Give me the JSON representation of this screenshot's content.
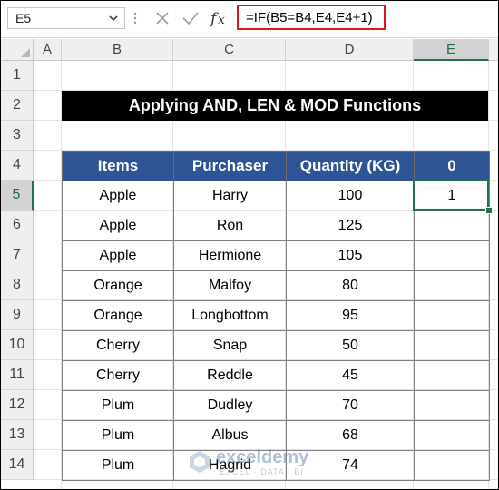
{
  "formula_bar": {
    "name_box": "E5",
    "formula": "=IF(B5=B4,E4,E4+1)",
    "icons": [
      "chevron-down-icon",
      "cancel-x-icon",
      "check-icon",
      "fx-icon"
    ]
  },
  "columns": [
    "A",
    "B",
    "C",
    "D",
    "E"
  ],
  "selected_column": "E",
  "rows": [
    "1",
    "2",
    "3",
    "4",
    "5",
    "6",
    "7",
    "8",
    "9",
    "10",
    "11",
    "12",
    "13",
    "14"
  ],
  "selected_row": "5",
  "sheet": {
    "title": "Applying AND, LEN & MOD Functions",
    "headers": [
      "Items",
      "Purchaser",
      "Quantity (KG)",
      "0"
    ],
    "data": [
      [
        "Apple",
        "Harry",
        "100",
        "1"
      ],
      [
        "Apple",
        "Ron",
        "125",
        ""
      ],
      [
        "Apple",
        "Hermione",
        "105",
        ""
      ],
      [
        "Orange",
        "Malfoy",
        "80",
        ""
      ],
      [
        "Orange",
        "Longbottom",
        "95",
        ""
      ],
      [
        "Cherry",
        "Snap",
        "50",
        ""
      ],
      [
        "Cherry",
        "Reddle",
        "45",
        ""
      ],
      [
        "Plum",
        "Dudley",
        "70",
        ""
      ],
      [
        "Plum",
        "Albus",
        "68",
        ""
      ],
      [
        "Plum",
        "Hagrid",
        "74",
        ""
      ]
    ]
  },
  "watermark": {
    "name": "exceldemy",
    "sub": "EXCEL · DATA · BI"
  },
  "colors": {
    "header_fill": "#2f5496",
    "title_fill": "#000000",
    "formula_border": "#e0141e",
    "selection": "#217346"
  }
}
